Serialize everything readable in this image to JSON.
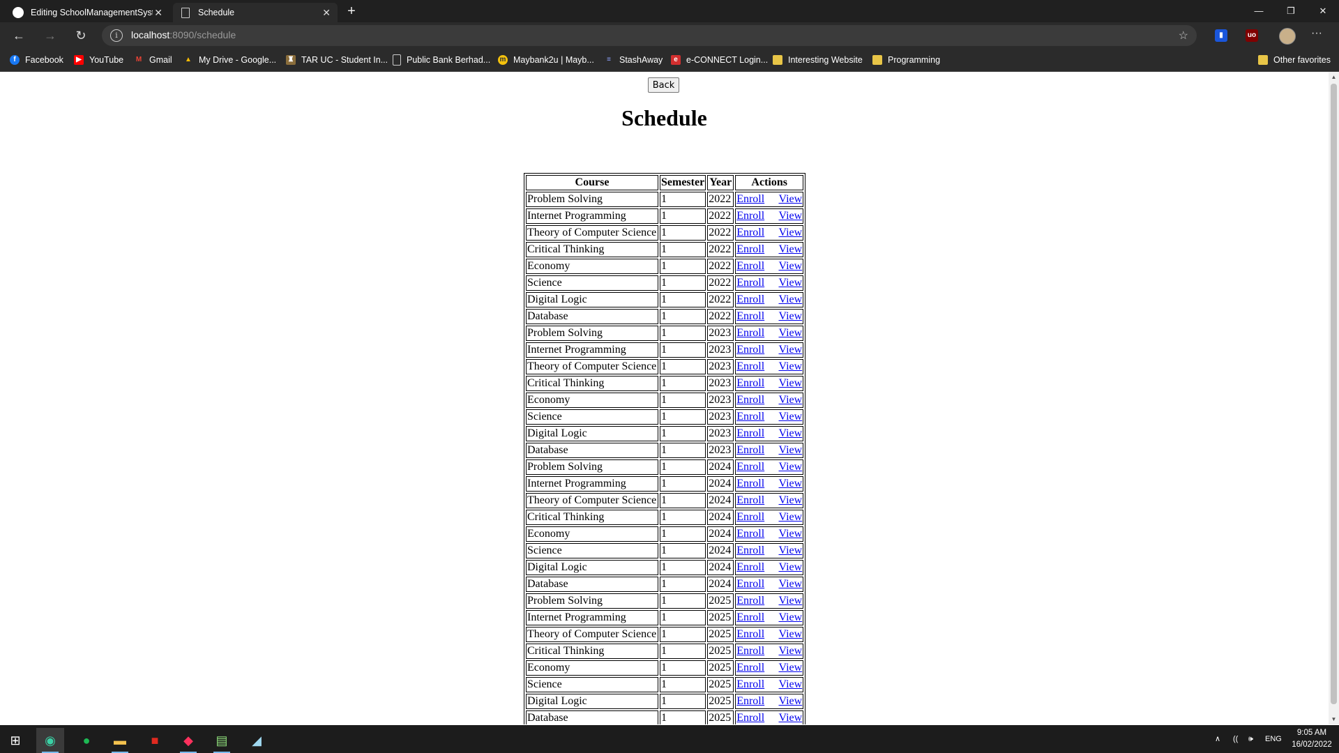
{
  "browser": {
    "tabs": [
      {
        "title": "Editing SchoolManagementSyste",
        "icon": "github-icon"
      },
      {
        "title": "Schedule",
        "icon": "page-icon"
      }
    ],
    "address": {
      "host": "localhost",
      "rest": ":8090/schedule"
    },
    "bookmarks": [
      {
        "label": "Facebook",
        "icon": "facebook-icon",
        "color": "#1877f2"
      },
      {
        "label": "YouTube",
        "icon": "youtube-icon",
        "color": "#ff0000"
      },
      {
        "label": "Gmail",
        "icon": "gmail-icon",
        "color": "#ea4335"
      },
      {
        "label": "My Drive - Google...",
        "icon": "drive-icon",
        "color": "#fbbc04"
      },
      {
        "label": "TAR UC - Student In...",
        "icon": "school-crest-icon",
        "color": "#8a6d3b"
      },
      {
        "label": "Public Bank Berhad...",
        "icon": "page-icon",
        "color": "#2b2b2b"
      },
      {
        "label": "Maybank2u | Mayb...",
        "icon": "maybank-icon",
        "color": "#f4c20d"
      },
      {
        "label": "StashAway",
        "icon": "stashaway-icon",
        "color": "#3b4a9b"
      },
      {
        "label": "e-CONNECT Login...",
        "icon": "econnect-icon",
        "color": "#d32f2f"
      },
      {
        "label": "Interesting Website",
        "icon": "folder-icon",
        "color": "#e8c547"
      },
      {
        "label": "Programming",
        "icon": "folder-icon",
        "color": "#e8c547"
      }
    ],
    "other_favorites": "Other favorites"
  },
  "page": {
    "back_label": "Back",
    "title": "Schedule",
    "table": {
      "headers": [
        "Course",
        "Semester",
        "Year",
        "Actions"
      ],
      "enroll_label": "Enroll",
      "view_label": "View",
      "rows": [
        {
          "course": "Problem Solving",
          "semester": "1",
          "year": "2022"
        },
        {
          "course": "Internet Programming",
          "semester": "1",
          "year": "2022"
        },
        {
          "course": "Theory of Computer Science",
          "semester": "1",
          "year": "2022"
        },
        {
          "course": "Critical Thinking",
          "semester": "1",
          "year": "2022"
        },
        {
          "course": "Economy",
          "semester": "1",
          "year": "2022"
        },
        {
          "course": "Science",
          "semester": "1",
          "year": "2022"
        },
        {
          "course": "Digital Logic",
          "semester": "1",
          "year": "2022"
        },
        {
          "course": "Database",
          "semester": "1",
          "year": "2022"
        },
        {
          "course": "Problem Solving",
          "semester": "1",
          "year": "2023"
        },
        {
          "course": "Internet Programming",
          "semester": "1",
          "year": "2023"
        },
        {
          "course": "Theory of Computer Science",
          "semester": "1",
          "year": "2023"
        },
        {
          "course": "Critical Thinking",
          "semester": "1",
          "year": "2023"
        },
        {
          "course": "Economy",
          "semester": "1",
          "year": "2023"
        },
        {
          "course": "Science",
          "semester": "1",
          "year": "2023"
        },
        {
          "course": "Digital Logic",
          "semester": "1",
          "year": "2023"
        },
        {
          "course": "Database",
          "semester": "1",
          "year": "2023"
        },
        {
          "course": "Problem Solving",
          "semester": "1",
          "year": "2024"
        },
        {
          "course": "Internet Programming",
          "semester": "1",
          "year": "2024"
        },
        {
          "course": "Theory of Computer Science",
          "semester": "1",
          "year": "2024"
        },
        {
          "course": "Critical Thinking",
          "semester": "1",
          "year": "2024"
        },
        {
          "course": "Economy",
          "semester": "1",
          "year": "2024"
        },
        {
          "course": "Science",
          "semester": "1",
          "year": "2024"
        },
        {
          "course": "Digital Logic",
          "semester": "1",
          "year": "2024"
        },
        {
          "course": "Database",
          "semester": "1",
          "year": "2024"
        },
        {
          "course": "Problem Solving",
          "semester": "1",
          "year": "2025"
        },
        {
          "course": "Internet Programming",
          "semester": "1",
          "year": "2025"
        },
        {
          "course": "Theory of Computer Science",
          "semester": "1",
          "year": "2025"
        },
        {
          "course": "Critical Thinking",
          "semester": "1",
          "year": "2025"
        },
        {
          "course": "Economy",
          "semester": "1",
          "year": "2025"
        },
        {
          "course": "Science",
          "semester": "1",
          "year": "2025"
        },
        {
          "course": "Digital Logic",
          "semester": "1",
          "year": "2025"
        },
        {
          "course": "Database",
          "semester": "1",
          "year": "2025"
        }
      ]
    }
  },
  "taskbar": {
    "apps": [
      "start-icon",
      "edge-icon",
      "spotify-icon",
      "file-explorer-icon",
      "acrobat-icon",
      "intellij-icon",
      "notepad-plus-icon",
      "notepad-icon"
    ],
    "language": "ENG",
    "time": "9:05 AM",
    "date": "16/02/2022"
  }
}
